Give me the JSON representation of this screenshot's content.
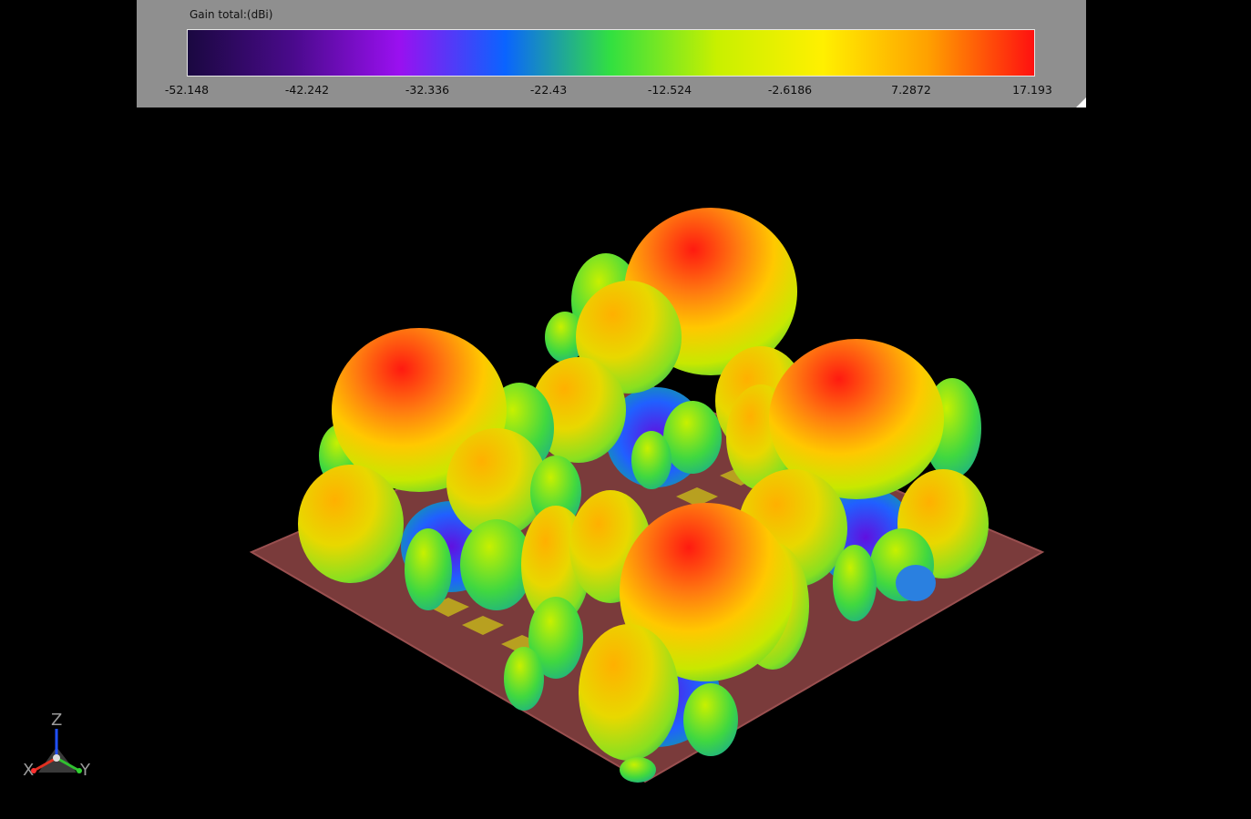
{
  "legend": {
    "title": "Gain total:(dBi)",
    "colorscale": [
      "#1a0840",
      "#4a0a8c",
      "#9a10f0",
      "#0a64ff",
      "#32e040",
      "#c8f000",
      "#fff000",
      "#ffa000",
      "#ff1010"
    ],
    "ticks": [
      "-52.148",
      "-42.242",
      "-32.336",
      "-22.43",
      "-12.524",
      "-2.6186",
      "7.2872",
      "17.193"
    ]
  },
  "scene": {
    "description_colors": {
      "background": "#000000",
      "substrate": "#7a3a3a",
      "patch": "#b8a020"
    }
  },
  "axes": {
    "x": "X",
    "y": "Y",
    "z": "Z"
  }
}
